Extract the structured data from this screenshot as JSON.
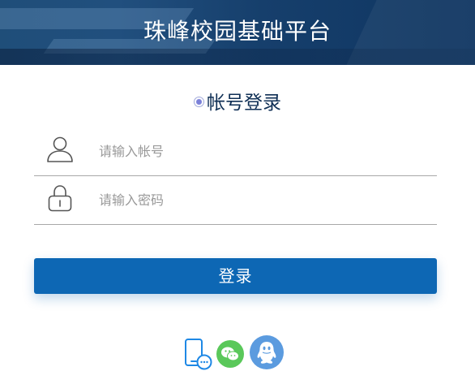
{
  "header": {
    "title": "珠峰校园基础平台"
  },
  "login_mode": {
    "label": "帐号登录"
  },
  "form": {
    "username": {
      "placeholder": "请输入帐号",
      "value": "",
      "icon": "user-icon"
    },
    "password": {
      "placeholder": "请输入密码",
      "value": "",
      "icon": "lock-icon"
    },
    "submit_label": "登录"
  },
  "alt_logins": [
    {
      "icon": "phone-chat-icon",
      "color": "#1e88e5"
    },
    {
      "icon": "wechat-icon",
      "color": "#5ac85a"
    },
    {
      "icon": "qq-icon",
      "color": "#5b9bdf"
    }
  ],
  "colors": {
    "banner": "#1f4e79",
    "primary_button": "#0d67b4",
    "title_text": "#0f2f55"
  }
}
